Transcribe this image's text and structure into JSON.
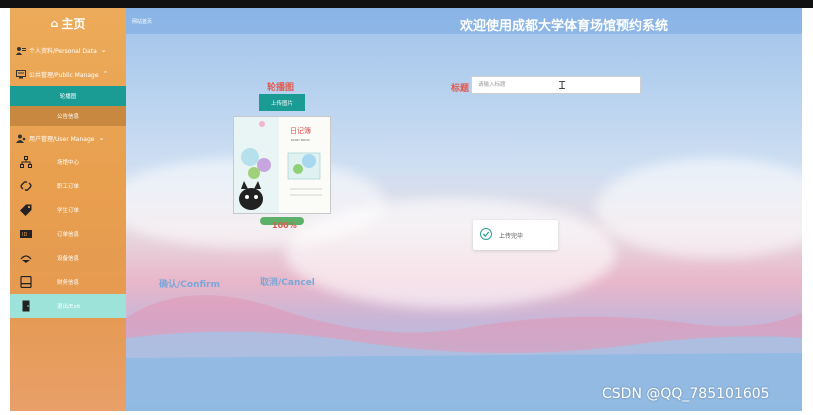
{
  "sidebar": {
    "home_icon": "home-icon",
    "home_label": "主页",
    "personal": {
      "label": "个人资料/Personal Data",
      "icon": "user-card-icon"
    },
    "public": {
      "label": "公共管理/Public Manage",
      "icon": "monitor-icon"
    },
    "carousel_label": "轮播图",
    "notice_label": "公告信息",
    "user_manage": {
      "label": "用户管理/User Manage",
      "icon": "users-icon"
    },
    "items": [
      {
        "label": "场馆中心",
        "icon": "sitemap-icon"
      },
      {
        "label": "职工订单",
        "icon": "link-icon"
      },
      {
        "label": "学生订单",
        "icon": "tag-icon"
      },
      {
        "label": "订单信息",
        "icon": "id-badge-icon"
      },
      {
        "label": "设备信息",
        "icon": "tool-icon"
      },
      {
        "label": "财务信息",
        "icon": "ledger-icon"
      },
      {
        "label": "退出/Exit",
        "icon": "door-icon"
      }
    ]
  },
  "topbar": {
    "home_link": "网站首页",
    "title": "欢迎使用成都大学体育场馆预约系统"
  },
  "form": {
    "carousel_label": "轮播图",
    "upload_button": "上传图片",
    "progress_text": "100%",
    "progress_value": 1.0,
    "title_label": "标题",
    "title_placeholder": "请输入标题",
    "confirm": "确认/Confirm",
    "cancel": "取消/Cancel"
  },
  "preview": {
    "heading": "日记簿",
    "subheading": "DIARY BOOK"
  },
  "toast": {
    "message": "上传完毕",
    "icon": "check-circle-icon"
  },
  "watermark": "CSDN @QQ_785101605",
  "colors": {
    "sidebar": "#e89f4e",
    "active": "#1a9c94",
    "accent_red": "#e05b4f",
    "link_blue": "#7aa7d8"
  }
}
